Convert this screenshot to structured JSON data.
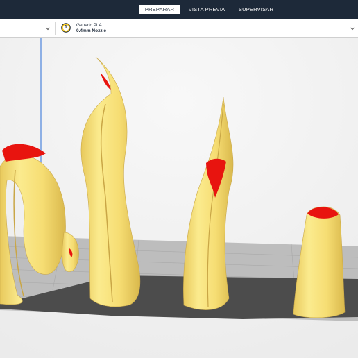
{
  "header": {
    "tabs": [
      {
        "label": "PREPARAR",
        "active": true
      },
      {
        "label": "VISTA PREVIA",
        "active": false
      },
      {
        "label": "SUPERVISAR",
        "active": false
      }
    ]
  },
  "toolbar": {
    "extruder_number": "1",
    "material_name": "Generic PLA",
    "nozzle": "0.4mm Nozzle"
  },
  "colors": {
    "topbar": "#1d2939",
    "model_yellow": "#f7e27a",
    "overhang_red": "#e8140f",
    "build_plate": "#b9b9b9",
    "model_shadow": "#4a4a4a"
  }
}
